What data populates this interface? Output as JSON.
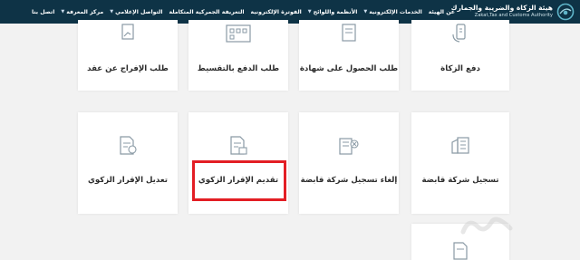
{
  "header": {
    "logo_ar": "هيئة الزكاة والضريبة والجمارك",
    "logo_en": "Zakat,Tax and Customs Authority",
    "nav": [
      {
        "label": "عن الهيئة",
        "chevron": false
      },
      {
        "label": "الخدمات الإلكترونية",
        "chevron": true
      },
      {
        "label": "الأنظمة واللوائح",
        "chevron": true
      },
      {
        "label": "الفوترة الإلكترونية",
        "chevron": false
      },
      {
        "label": "التعريفة الجمركية المتكاملة",
        "chevron": false
      },
      {
        "label": "التواصل الإعلامي",
        "chevron": true
      },
      {
        "label": "مركز المعرفة",
        "chevron": true
      },
      {
        "label": "اتصل بنا",
        "chevron": false
      }
    ]
  },
  "cards": {
    "row1": [
      "دفع الزكاة",
      "طلب الحصول على شهادة",
      "طلب الدفع بالتقسيط",
      "طلب الإفراج عن عقد"
    ],
    "row2": [
      "تسجيل شركة قابضة",
      "إلغاء تسجيل شركة قابضة",
      "تقديم الإقرار الزكوي",
      "تعديل الإقرار الزكوي"
    ]
  },
  "colors": {
    "header_bg": "#0e3346",
    "highlight": "#e31e24",
    "icon": "#8a9aa5"
  },
  "icons": {
    "row1": [
      "phone-payment-icon",
      "certificate-icon",
      "installment-calendar-icon",
      "contract-release-icon"
    ],
    "row2": [
      "building-icon",
      "building-cancel-icon",
      "document-submit-icon",
      "document-edit-icon"
    ],
    "row3": [
      "document-icon"
    ]
  }
}
